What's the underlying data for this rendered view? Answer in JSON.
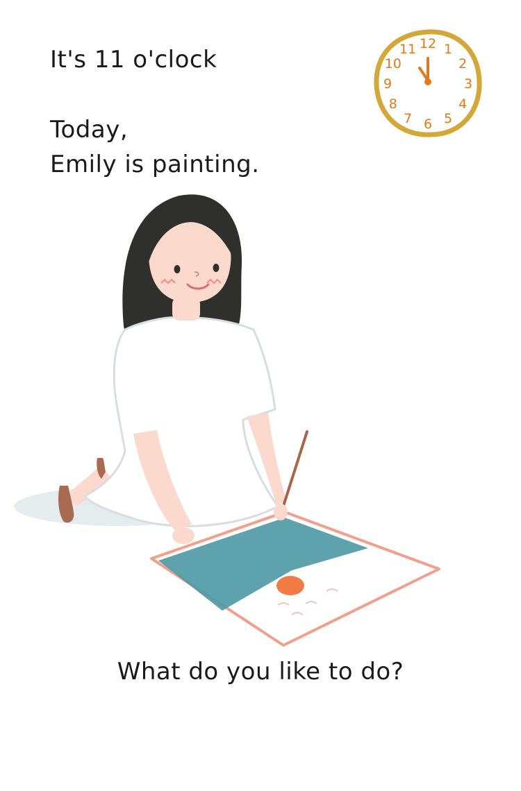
{
  "text": {
    "time": "It's 11 o'clock",
    "today": "Today,",
    "activity": "Emily is painting.",
    "question": "What do you like to do?"
  },
  "clock": {
    "numbers": [
      "12",
      "1",
      "2",
      "3",
      "4",
      "5",
      "6",
      "7",
      "8",
      "9",
      "10",
      "11"
    ],
    "hour": 11,
    "minute": 0,
    "color_face": "#d4a838",
    "color_numbers": "#e07a1c"
  },
  "colors": {
    "hair": "#2f2f2c",
    "skin": "#fbd9cc",
    "dress": "#ffffff",
    "paint": "#4f9aa6",
    "paper_border": "#f0a08c",
    "sun": "#f07b45",
    "shoe": "#a96a52",
    "brush": "#a8654a"
  }
}
